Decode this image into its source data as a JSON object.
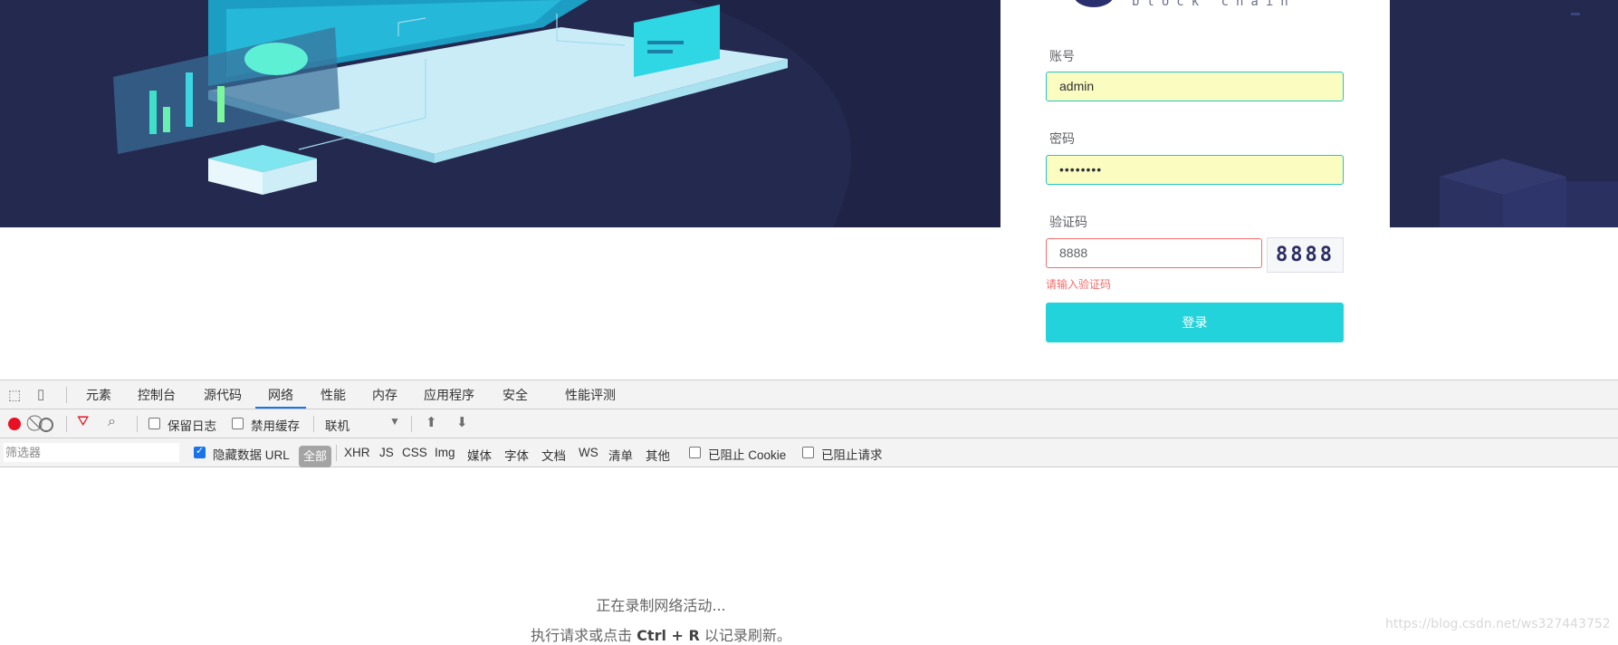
{
  "login": {
    "logo_text": "block chain",
    "account_label": "账号",
    "account_value": "admin",
    "password_label": "密码",
    "password_value": "••••••••",
    "captcha_label": "验证码",
    "captcha_value": "8888",
    "captcha_image_text": "8888",
    "captcha_error": "请输入验证码",
    "login_button": "登录"
  },
  "devtools": {
    "tabs": [
      "元素",
      "控制台",
      "源代码",
      "网络",
      "性能",
      "内存",
      "应用程序",
      "安全",
      "性能评测"
    ],
    "active_tab": "网络",
    "toolbar": {
      "preserve_log": "保留日志",
      "disable_cache": "禁用缓存",
      "throttling": "联机"
    },
    "filter": {
      "placeholder": "筛选器",
      "hide_data_urls": "隐藏数据 URL",
      "types": [
        "全部",
        "XHR",
        "JS",
        "CSS",
        "Img",
        "媒体",
        "字体",
        "文档",
        "WS",
        "清单",
        "其他"
      ],
      "blocked_cookies": "已阻止 Cookie",
      "blocked_requests": "已阻止请求"
    },
    "empty_line1": "正在录制网络活动...",
    "empty_line2_pre": "执行请求或点击 ",
    "empty_line2_key": "Ctrl + R",
    "empty_line2_post": " 以记录刷新。"
  },
  "watermark": "https://blog.csdn.net/ws327443752",
  "colors": {
    "banner_bg": "#24294f",
    "accent": "#23d3db",
    "error": "#f56c6c",
    "devtools_active": "#1a73e8"
  }
}
